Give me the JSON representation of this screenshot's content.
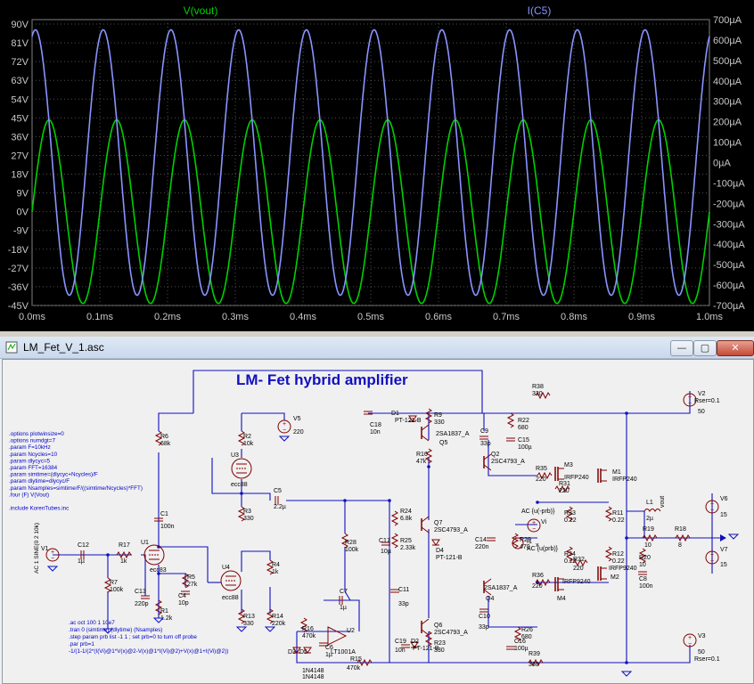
{
  "plot": {
    "trace_left_label": "V(vout)",
    "trace_right_label": "I(C5)",
    "trace_left_color": "#00d000",
    "trace_right_color": "#8a93ff",
    "background": "#000000",
    "y_left_ticks": [
      "90V",
      "81V",
      "72V",
      "63V",
      "54V",
      "45V",
      "36V",
      "27V",
      "18V",
      "9V",
      "0V",
      "-9V",
      "-18V",
      "-27V",
      "-36V",
      "-45V"
    ],
    "y_right_ticks": [
      "700µA",
      "600µA",
      "500µA",
      "400µA",
      "300µA",
      "200µA",
      "100µA",
      "0µA",
      "-100µA",
      "-200µA",
      "-300µA",
      "-400µA",
      "-500µA",
      "-600µA",
      "-700µA"
    ],
    "x_ticks": [
      "0.0ms",
      "0.1ms",
      "0.2ms",
      "0.3ms",
      "0.4ms",
      "0.5ms",
      "0.6ms",
      "0.7ms",
      "0.8ms",
      "0.9ms",
      "1.0ms"
    ]
  },
  "chart_data": {
    "type": "line",
    "title": "",
    "xlabel": "",
    "ylabel": "",
    "x_unit": "ms",
    "xlim": [
      0,
      1.0
    ],
    "ylim_left": [
      -45,
      90
    ],
    "ylim_right": [
      -700,
      700
    ],
    "grid": true,
    "series": [
      {
        "name": "V(vout)",
        "axis": "left",
        "shape": "sine",
        "frequency_khz": 10,
        "amplitude": 44,
        "offset": 0,
        "phase_peak_ms": 0.025
      },
      {
        "name": "I(C5)",
        "axis": "right",
        "shape": "sine",
        "frequency_khz": 10,
        "amplitude": 650,
        "offset": 0,
        "phase_peak_ms": 0.005
      }
    ]
  },
  "window": {
    "title": "LM_Fet_V_1.asc",
    "minimize": "—",
    "maximize": "▢",
    "close": "✕"
  },
  "schematic": {
    "heading": "LM- Fet hybrid amplifier",
    "directives": [
      ".options plotwinsize=0",
      ".options numdgt=7",
      ".param F=10kHz",
      ".param Ncycles=10",
      ".param dlycyc=5",
      ".param FFT=16384",
      ".param simtime=(dlycyc+Ncycles)/F",
      ".param dlytime=dlycyc/F",
      ".param Nsamples=simtime/F/((simtime/Ncycles)*FFT)",
      ".four (F) V(Vout)",
      "",
      ".include KorenTubes.inc"
    ],
    "analysis": [
      ".ac oct 100 1 10e7",
      ".tran 0 (simtime) (dlytime) (Nsamples)",
      ".step param prb list -1 1 ; set prb=0 to turn off probe",
      ".par prb=1",
      "-1/(1-1/(2*(I(Vi)@1*V(x)@2-V(x)@1*I(Vi)@2)+V(x)@1+I(Vi)@2))"
    ],
    "labels": {
      "R6": "R6",
      "R6v": "68k",
      "R2": "R2",
      "R2v": "10k",
      "V5": "V5",
      "V5v": "220",
      "U3": "U3",
      "U3v": "ecc88",
      "R3": "R3",
      "R3v": "330",
      "C5": "C5",
      "C5v": "2.2µ",
      "C1": "C1",
      "C1v": "100n",
      "U1": "U1",
      "U1v": "ecc83",
      "C4": "C4",
      "C4v": "10p",
      "R5": "R5",
      "R5v": "27k",
      "U4": "U4",
      "U4v": "ecc88",
      "R4": "R4",
      "R4v": "1k",
      "R7": "R7",
      "R7v": "100k",
      "C13": "C13",
      "C13v": "220p",
      "R1": "R1",
      "R1v": "1.2k",
      "R13": "R13",
      "R13v": "330",
      "R14": "R14",
      "R14v": "220k",
      "C12": "C12",
      "C12v": "1µ",
      "R17": "R17",
      "R17v": "1k",
      "V1": "V1",
      "V1v": "AC 1 SINE(0 2 10k)",
      "C18": "C18",
      "C18v": "10n",
      "D1": "D1",
      "D1v": "PT-121-B",
      "R9": "R9",
      "R9v": "330",
      "R10": "R10",
      "R10v": "47k",
      "Q5": "Q5",
      "Q5v": "2SA1837_A",
      "R28": "R28",
      "R28v": "100k",
      "R24": "R24",
      "R24v": "6.8k",
      "R25": "R25",
      "R25v": "2.33k",
      "C17": "C17",
      "C17v": "10µ",
      "Q7": "Q7",
      "Q7v": "2SC4793_A",
      "D4": "D4",
      "D4v": "PT-121-B",
      "C11": "C11",
      "C11v": "33p",
      "Q6": "Q6",
      "Q6v": "2SC4793_A",
      "D2": "D2",
      "D2v": "PT-121-B",
      "C19": "C19",
      "C19v": "10n",
      "R23": "R23",
      "R23v": "330",
      "R16": "R16",
      "R16v": "470k",
      "C7": "C7",
      "C7v": "1µ",
      "U2": "U2",
      "U2v": "LT1001A",
      "C6": "C6",
      "C6v": "1µ",
      "D3": "D3",
      "D3v": "1N4148",
      "D5": "D5",
      "D5v": "1N4148",
      "R15": "R15",
      "R15v": "470k",
      "R22": "R22",
      "R22v": "680",
      "C15": "C15",
      "C15v": "100µ",
      "C9": "C9",
      "C9v": "33p",
      "Q2": "Q2",
      "Q2v": "2SC4793_A",
      "R38": "R38",
      "R38v": "330",
      "R35": "R35",
      "R35v": "220",
      "R31": "R31",
      "R31v": "220",
      "M3": "M3",
      "M3v": "IRFP240",
      "M1": "M1",
      "M1v": "IRFP240",
      "R33": "R33",
      "R33v": "0.22",
      "R11": "R11",
      "R11v": "0.22",
      "C14": "C14",
      "C14v": "220n",
      "R29": "R29",
      "R29v": "470",
      "R34": "R34",
      "R34v": "0.22",
      "R12": "R12",
      "R12v": "0.22",
      "R32": "R32",
      "R32v": "220",
      "R36": "R36",
      "R36v": "220",
      "M4": "M4",
      "M4v": "IRFP9240",
      "M2": "M2",
      "M2v": "IRFP9240",
      "Q4": "Q4",
      "Q4v": "2SA1837_A",
      "C10": "C10",
      "C10v": "33p",
      "R26": "R26",
      "R26v": "680",
      "C16": "C16",
      "C16v": "100µ",
      "R39": "R39",
      "R39v": "330",
      "Vi": "Vi",
      "Viv": "AC {u(-prb)}",
      "I1": "I1",
      "I1v": "AC {u(prb)}",
      "L1": "L1",
      "L1v": "2µ",
      "R19": "R19",
      "R19v": "10",
      "R20": "R20",
      "R20v": "10",
      "C8": "C8",
      "C8v": "100n",
      "R18": "R18",
      "R18v": "8",
      "vout": "vout",
      "x": "x",
      "V2": "V2",
      "V2v": "50",
      "V2r": "Rser=0.1",
      "V3": "V3",
      "V3v": "50",
      "V3r": "Rser=0.1",
      "V6": "V6",
      "V6v": "15",
      "V7": "V7",
      "V7v": "15"
    }
  }
}
